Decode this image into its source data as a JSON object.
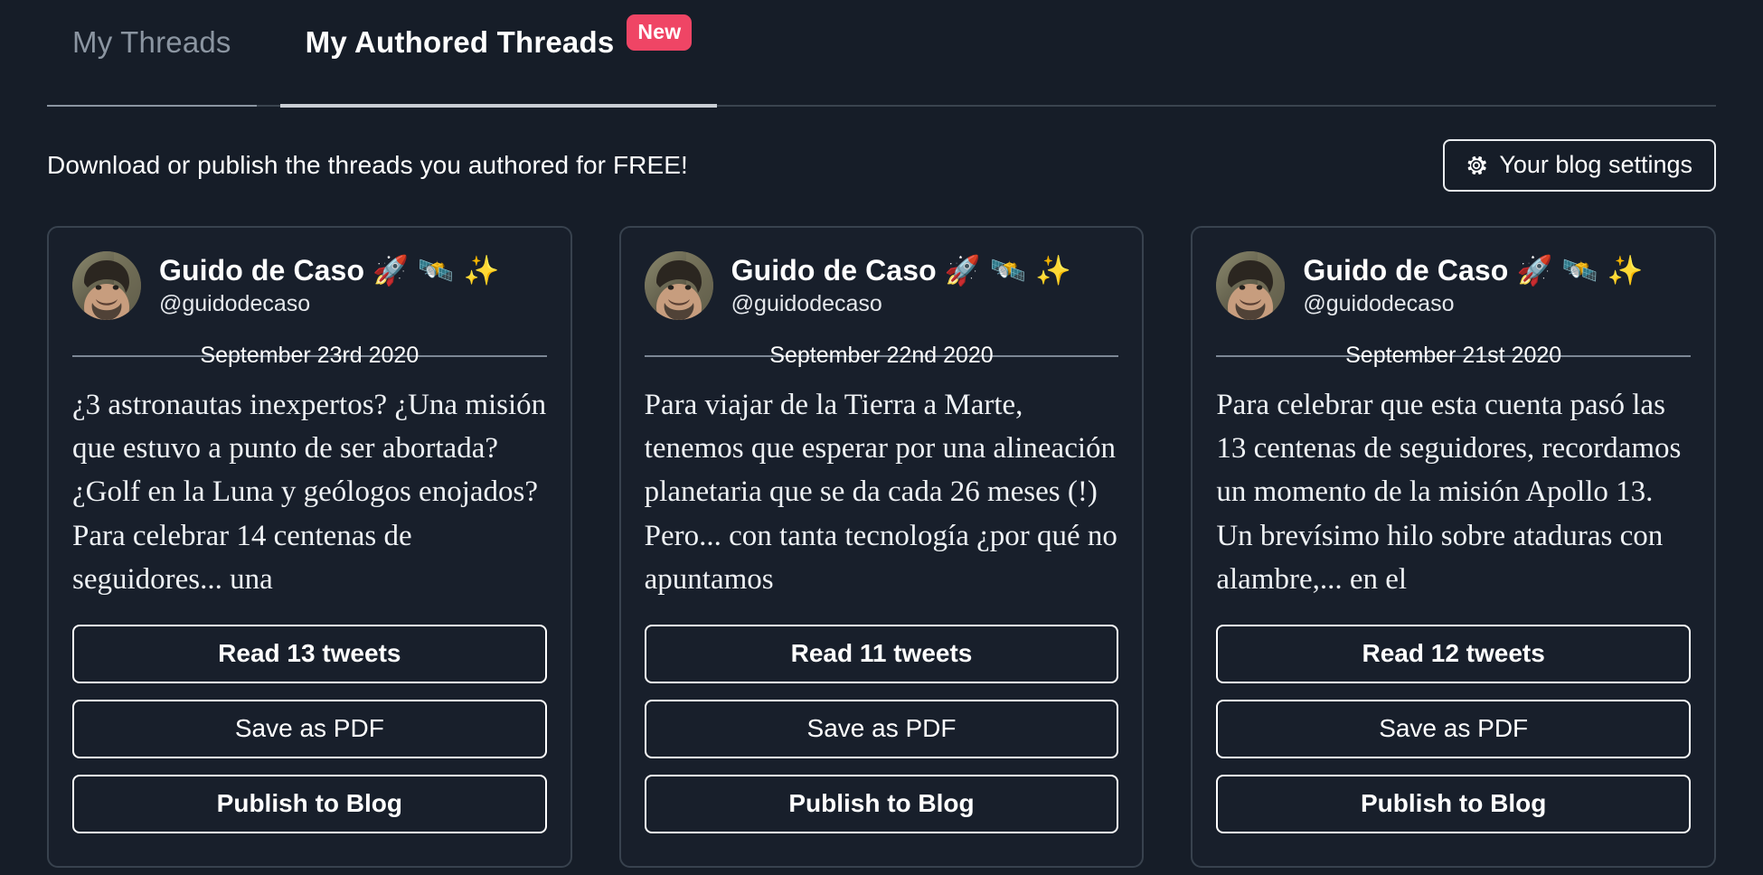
{
  "tabs": [
    {
      "label": "My Threads",
      "active": false,
      "badge": null
    },
    {
      "label": "My Authored Threads",
      "active": true,
      "badge": "New"
    }
  ],
  "subheader": {
    "text": "Download or publish the threads you authored for FREE!",
    "settings_button": "Your blog settings",
    "settings_icon": "gear-icon"
  },
  "colors": {
    "page_background": "#161d28",
    "card_background": "#181f2b",
    "card_border": "#38424e",
    "badge_new": "#ef4565",
    "tab_active_text": "#ffffff",
    "tab_inactive_text": "#8b95a1",
    "button_border": "#ffffff",
    "divider": "#7c8795"
  },
  "author": {
    "display_name": "Guido de Caso",
    "emojis": "🚀 🛰️ ✨",
    "handle": "@guidodecaso",
    "avatar": "author-avatar"
  },
  "cards": [
    {
      "date": "September 23rd 2020",
      "excerpt": "¿3 astronautas inexpertos? ¿Una misión que estuvo a punto de ser abortada? ¿Golf en la Luna y geólogos enojados? Para celebrar 14 centenas de seguidores... una",
      "read_label": "Read 13 tweets",
      "tweet_count": 13,
      "save_label": "Save as PDF",
      "publish_label": "Publish to Blog"
    },
    {
      "date": "September 22nd 2020",
      "excerpt": "Para viajar de la Tierra a Marte, tenemos que esperar por una alineación planetaria que se da cada 26 meses (!) Pero... con tanta tecnología ¿por qué no apuntamos",
      "read_label": "Read 11 tweets",
      "tweet_count": 11,
      "save_label": "Save as PDF",
      "publish_label": "Publish to Blog"
    },
    {
      "date": "September 21st 2020",
      "excerpt": "Para celebrar que esta cuenta pasó las 13 centenas de seguidores, recordamos un momento de la misión Apollo 13. Un brevísimo hilo sobre ataduras con alambre,... en el",
      "read_label": "Read 12 tweets",
      "tweet_count": 12,
      "save_label": "Save as PDF",
      "publish_label": "Publish to Blog"
    }
  ]
}
